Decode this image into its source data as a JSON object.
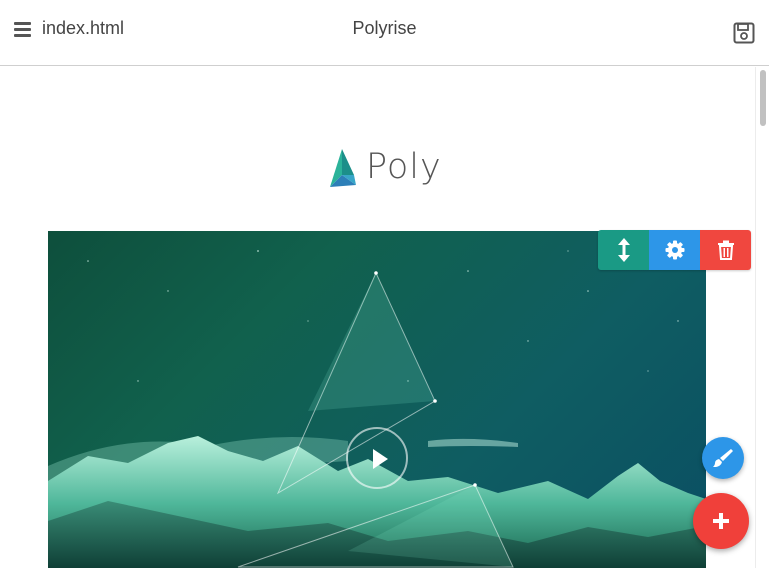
{
  "header": {
    "file_name": "index.html",
    "app_title": "Polyrise",
    "menu_icon": "hamburger-menu-icon",
    "save_icon": "floppy-disk-icon"
  },
  "page": {
    "logo_text": "Poly",
    "logo_icon": "poly-triangle-logo-icon"
  },
  "hero_block": {
    "play_icon": "play-icon",
    "toolbar": [
      {
        "name": "resize",
        "icon": "vertical-resize-icon",
        "color": "#1a9a85"
      },
      {
        "name": "settings",
        "icon": "gear-icon",
        "color": "#2d96e8"
      },
      {
        "name": "delete",
        "icon": "trash-icon",
        "color": "#f0473f"
      }
    ]
  },
  "fabs": {
    "brush": {
      "icon": "paintbrush-icon",
      "color": "#2d96e8"
    },
    "add": {
      "icon": "plus-icon",
      "color": "#f0403a"
    }
  }
}
